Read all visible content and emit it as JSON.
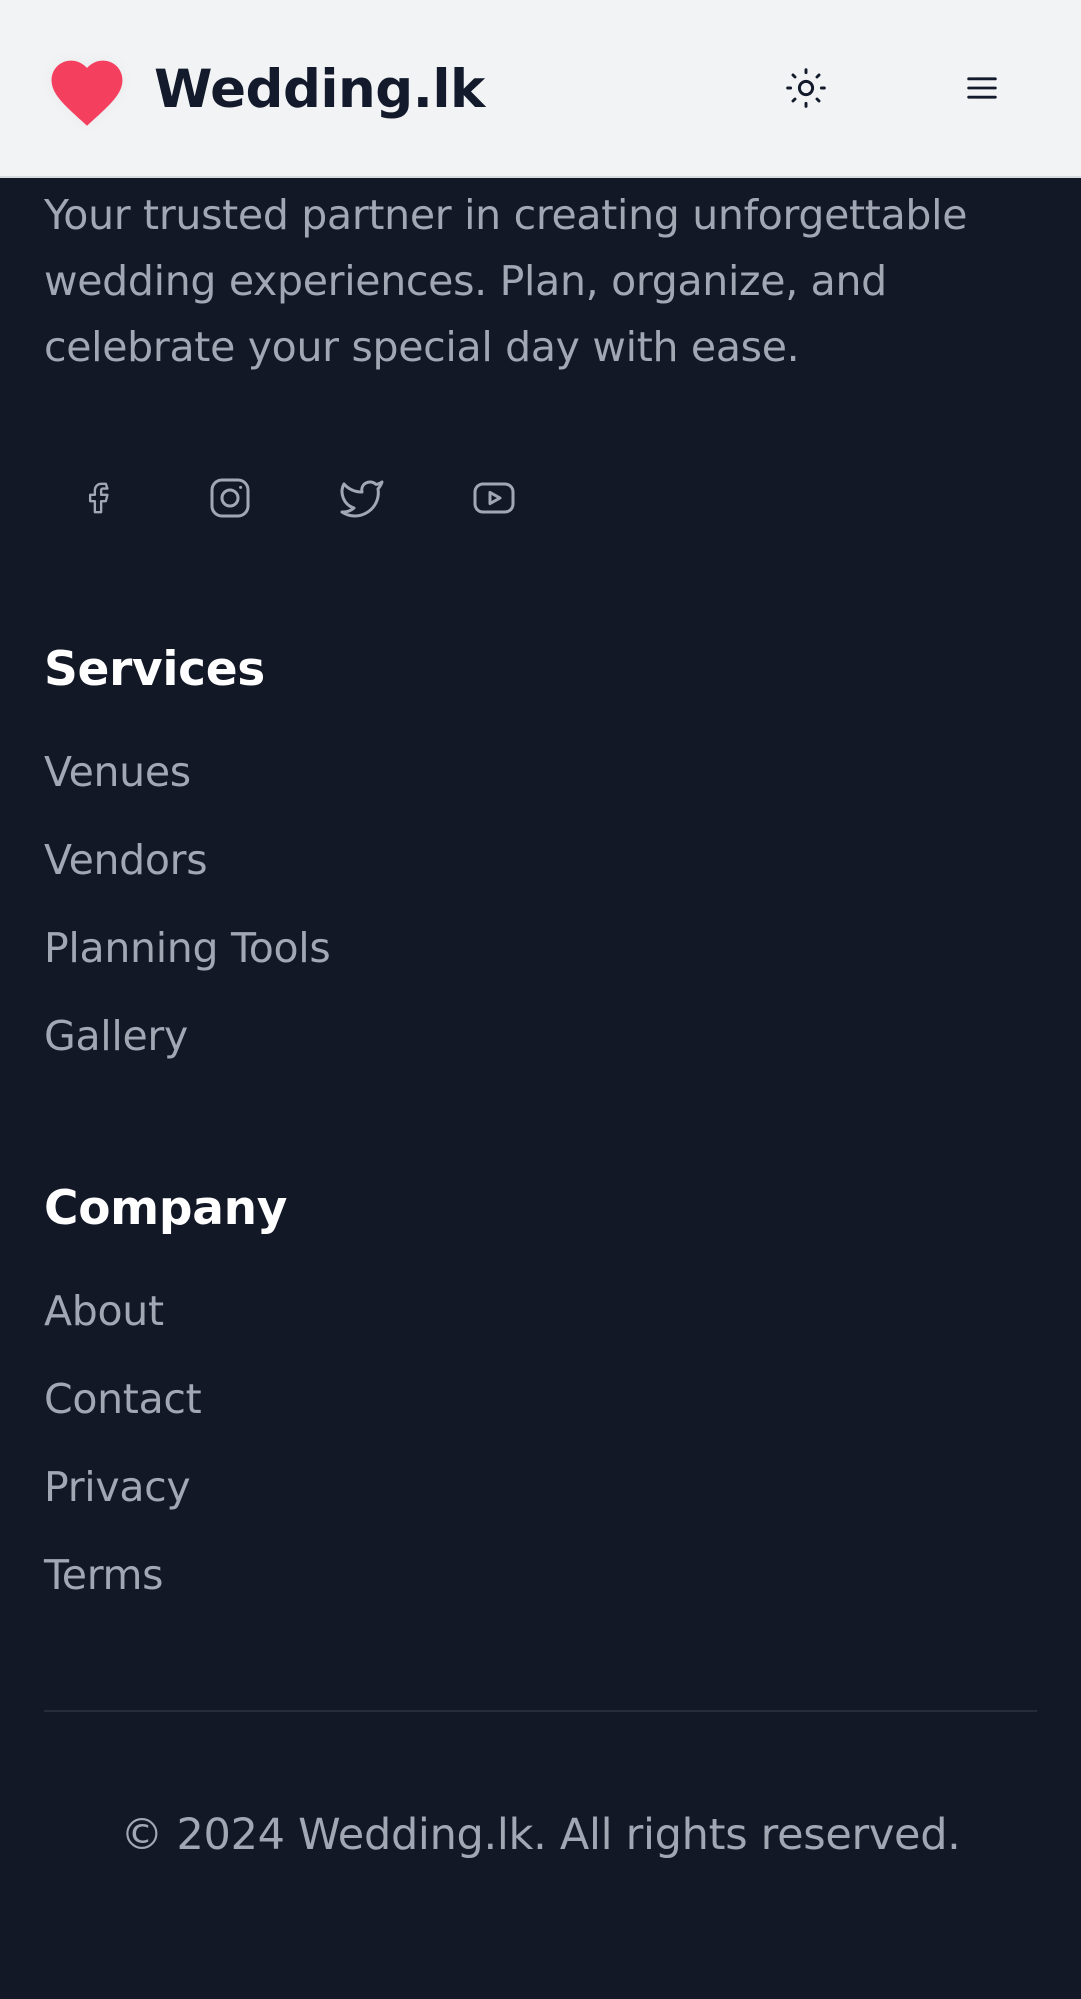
{
  "header": {
    "brand": "Wedding.lk",
    "logo_icon": "heart-icon",
    "theme_toggle_icon": "sun-icon",
    "menu_icon": "hamburger-menu-icon",
    "brand_color": "#f43f5e"
  },
  "footer": {
    "tagline": "Your trusted partner in creating unforgettable wedding experiences. Plan, organize, and celebrate your special day with ease.",
    "socials": [
      {
        "icon": "facebook-icon"
      },
      {
        "icon": "instagram-icon"
      },
      {
        "icon": "twitter-icon"
      },
      {
        "icon": "youtube-icon"
      }
    ],
    "services": {
      "title": "Services",
      "links": [
        "Venues",
        "Vendors",
        "Planning Tools",
        "Gallery"
      ]
    },
    "company": {
      "title": "Company",
      "links": [
        "About",
        "Contact",
        "Privacy",
        "Terms"
      ]
    },
    "copyright": "© 2024 Wedding.lk. All rights reserved."
  },
  "colors": {
    "background": "#131827",
    "header_background": "#f2f3f5",
    "muted_text": "#a2a7b4",
    "heading_text": "#ffffff"
  }
}
